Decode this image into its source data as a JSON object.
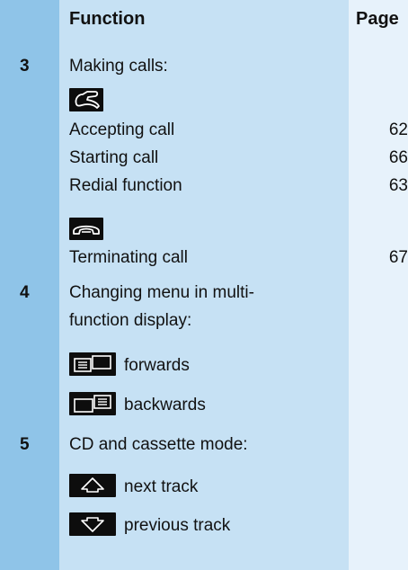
{
  "header": {
    "function": "Function",
    "page": "Page"
  },
  "sections": [
    {
      "number": "3",
      "title": "Making calls:",
      "groups": [
        {
          "icon": "phone-answer-icon",
          "items": [
            {
              "label": "Accepting call",
              "page": "62"
            },
            {
              "label": "Starting call",
              "page": "66"
            },
            {
              "label": "Redial function",
              "page": "63"
            }
          ]
        },
        {
          "icon": "phone-hangup-icon",
          "items": [
            {
              "label": "Terminating call",
              "page": "67"
            }
          ]
        }
      ]
    },
    {
      "number": "4",
      "title_line1": "Changing menu in multi-",
      "title_line2": "function display:",
      "items": [
        {
          "icon": "menu-forward-icon",
          "label": "forwards"
        },
        {
          "icon": "menu-backward-icon",
          "label": "backwards"
        }
      ]
    },
    {
      "number": "5",
      "title": "CD and cassette mode:",
      "items": [
        {
          "icon": "arrow-up-icon",
          "label": "next track"
        },
        {
          "icon": "arrow-down-icon",
          "label": "previous track"
        }
      ]
    }
  ]
}
